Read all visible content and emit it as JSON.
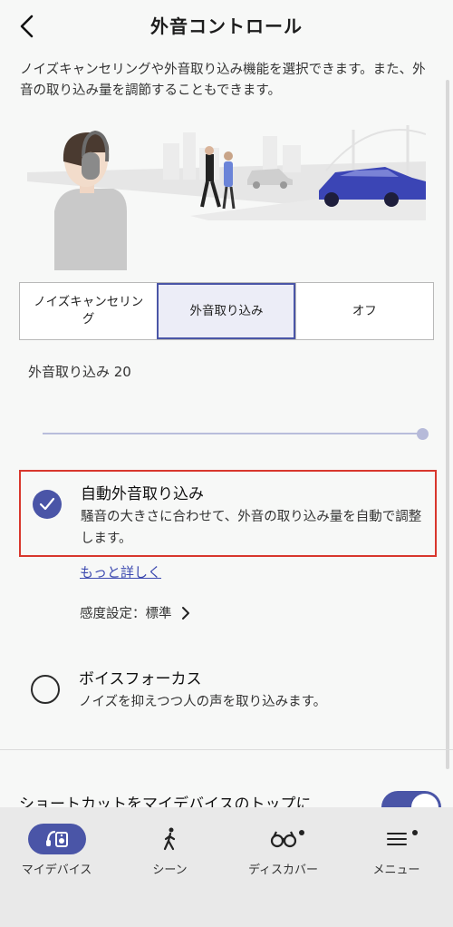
{
  "header": {
    "title": "外音コントロール"
  },
  "description": "ノイズキャンセリングや外音取り込み機能を選択できます。また、外音の取り込み量を調節することもできます。",
  "mode_selector": {
    "options": [
      "ノイズキャンセリング",
      "外音取り込み",
      "オフ"
    ],
    "selected": "外音取り込み"
  },
  "ambient_level": {
    "label": "外音取り込み 20",
    "value": 20,
    "max": 20
  },
  "options": {
    "auto": {
      "title": "自動外音取り込み",
      "subtitle": "騒音の大きさに合わせて、外音の取り込み量を自動で調整します。",
      "selected": true
    },
    "more_link": "もっと詳しく",
    "sensitivity": "感度設定：標準",
    "voice_focus": {
      "title": "ボイスフォーカス",
      "subtitle": "ノイズを抑えつつ人の声を取り込みます。",
      "selected": false
    }
  },
  "shortcut": {
    "label": "ショートカットをマイデバイスのトップに",
    "enabled": true
  },
  "tabs": [
    {
      "label": "マイデバイス",
      "icon": "headphones-device-icon",
      "active": true
    },
    {
      "label": "シーン",
      "icon": "walking-person-icon",
      "active": false
    },
    {
      "label": "ディスカバー",
      "icon": "binoculars-icon",
      "active": false
    },
    {
      "label": "メニュー",
      "icon": "menu-icon",
      "active": false
    }
  ],
  "colors": {
    "accent": "#4a55a7",
    "highlight_border": "#d8372d",
    "background": "#f7f8f7",
    "tabbar": "#e9e9e9"
  }
}
